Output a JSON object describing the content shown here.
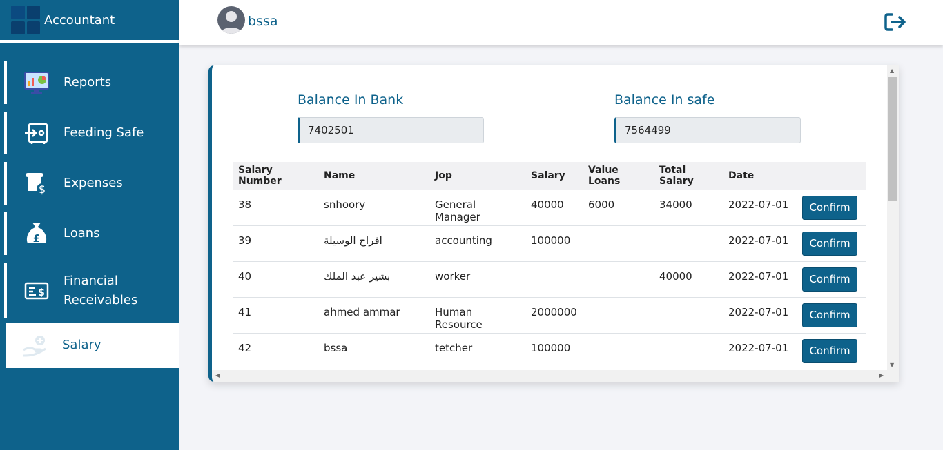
{
  "app": {
    "title": "Accountant"
  },
  "header": {
    "username": "bssa"
  },
  "sidebar": {
    "items": [
      {
        "label": "Reports",
        "icon": "reports-icon"
      },
      {
        "label": "Feeding Safe",
        "icon": "feeding-safe-icon"
      },
      {
        "label": "Expenses",
        "icon": "expenses-icon"
      },
      {
        "label": "Loans",
        "icon": "loans-icon"
      },
      {
        "label": "Financial Receivables",
        "icon": "financial-receivables-icon"
      },
      {
        "label": "Salary",
        "icon": "salary-icon",
        "active": true
      }
    ]
  },
  "balances": {
    "bank_label": "Balance In Bank",
    "bank_value": "7402501",
    "safe_label": "Balance In safe",
    "safe_value": "7564499"
  },
  "table": {
    "headers": [
      "Salary Number",
      "Name",
      "Jop",
      "Salary",
      "Value Loans",
      "Total Salary",
      "Date",
      ""
    ],
    "rows": [
      {
        "number": "38",
        "name": "snhoory",
        "job": "General Manager",
        "salary": "40000",
        "loans": "6000",
        "total": "34000",
        "date": "2022-07-01",
        "action": "Confirm"
      },
      {
        "number": "39",
        "name": "افراح الوسيلة",
        "job": "accounting",
        "salary": "100000",
        "loans": "",
        "total": "",
        "date": "2022-07-01",
        "action": "Confirm"
      },
      {
        "number": "40",
        "name": "بشير عبد الملك",
        "job": "worker",
        "salary": "",
        "loans": "",
        "total": "40000",
        "date": "2022-07-01",
        "action": "Confirm"
      },
      {
        "number": "41",
        "name": "ahmed ammar",
        "job": "Human Resource",
        "salary": "2000000",
        "loans": "",
        "total": "",
        "date": "2022-07-01",
        "action": "Confirm"
      },
      {
        "number": "42",
        "name": "bssa",
        "job": "tetcher",
        "salary": "100000",
        "loans": "",
        "total": "",
        "date": "2022-07-01",
        "action": "Confirm"
      }
    ]
  },
  "colors": {
    "primary": "#0e628b",
    "background": "#f3f4f8"
  }
}
